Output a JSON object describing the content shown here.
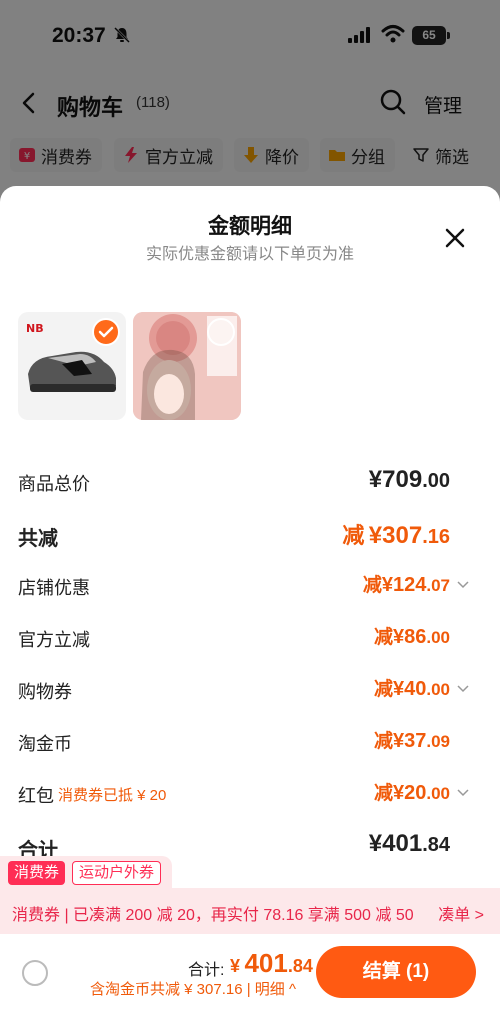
{
  "status": {
    "time": "20:37",
    "battery": "65"
  },
  "nav": {
    "title": "购物车",
    "count": "(118)",
    "manage": "管理"
  },
  "chips": [
    "消费券",
    "官方立减",
    "降价",
    "分组",
    "筛选"
  ],
  "sheet": {
    "title": "金额明细",
    "subtitle": "实际优惠金额请以下单页为准",
    "rows": [
      {
        "label": "商品总价",
        "prefix": "",
        "symbol": "¥",
        "int": "709",
        "dec": ".00"
      },
      {
        "label": "共减",
        "prefix": "减",
        "symbol": "¥",
        "int": "307",
        "dec": ".16"
      },
      {
        "label": "店铺优惠",
        "prefix": "减",
        "symbol": "¥",
        "int": "124",
        "dec": ".07"
      },
      {
        "label": "官方立减",
        "prefix": "减",
        "symbol": "¥",
        "int": "86",
        "dec": ".00"
      },
      {
        "label": "购物券",
        "prefix": "减",
        "symbol": "¥",
        "int": "40",
        "dec": ".00"
      },
      {
        "label": "淘金币",
        "prefix": "减",
        "symbol": "¥",
        "int": "37",
        "dec": ".09"
      },
      {
        "label": "红包",
        "note": "消费券已抵 ¥ 20",
        "prefix": "减",
        "symbol": "¥",
        "int": "20",
        "dec": ".00"
      },
      {
        "label": "合计",
        "prefix": "",
        "symbol": "¥",
        "int": "401",
        "dec": ".84"
      }
    ]
  },
  "badges": {
    "red": "消费券",
    "outline": "运动户外券"
  },
  "promo": {
    "text": "消费券 | 已凑满 200 减 20，再实付 78.16 享满 500 减 50",
    "link": "凑单 >"
  },
  "bottom": {
    "total_label": "合计:",
    "total_symbol": "¥",
    "total_int": "401",
    "total_dec": ".84",
    "coin_note": "含淘金币共减 ¥ 307.16 | 明细 ^",
    "checkout": "结算 (1)"
  },
  "colors": {
    "accent": "#ff5a12",
    "discount": "#f05a0a",
    "promo": "#e8264a"
  }
}
